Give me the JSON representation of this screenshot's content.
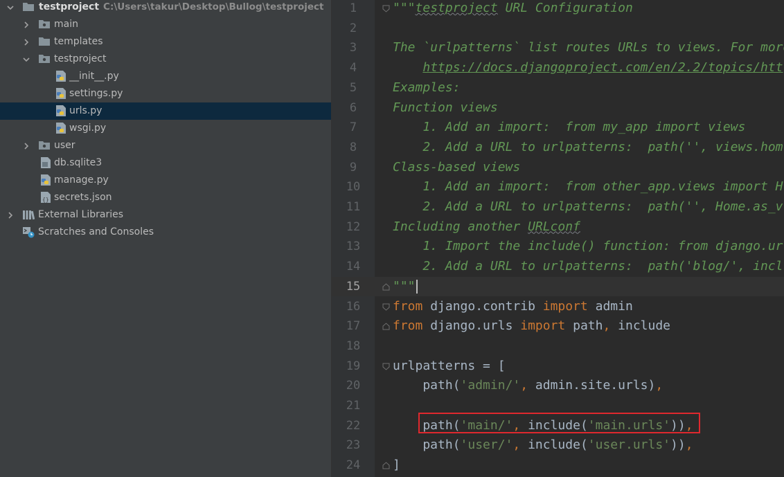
{
  "project_tree": {
    "root": {
      "label": "testproject",
      "path": "C:\\Users\\takur\\Desktop\\Bullog\\testproject"
    },
    "items": [
      {
        "label": "main",
        "type": "folder",
        "expanded": false
      },
      {
        "label": "templates",
        "type": "folder",
        "expanded": false
      },
      {
        "label": "testproject",
        "type": "folder",
        "expanded": true
      },
      {
        "label": "__init__.py",
        "type": "python-file"
      },
      {
        "label": "settings.py",
        "type": "python-file"
      },
      {
        "label": "urls.py",
        "type": "python-file",
        "selected": true
      },
      {
        "label": "wsgi.py",
        "type": "python-file"
      },
      {
        "label": "user",
        "type": "folder",
        "expanded": false
      },
      {
        "label": "db.sqlite3",
        "type": "file"
      },
      {
        "label": "manage.py",
        "type": "python-file"
      },
      {
        "label": "secrets.json",
        "type": "json-file"
      },
      {
        "label": "External Libraries",
        "type": "libraries"
      },
      {
        "label": "Scratches and Consoles",
        "type": "scratches"
      }
    ]
  },
  "editor": {
    "current_line": 15,
    "line_numbers": [
      "1",
      "2",
      "3",
      "4",
      "5",
      "6",
      "7",
      "8",
      "9",
      "10",
      "11",
      "12",
      "13",
      "14",
      "15",
      "16",
      "17",
      "18",
      "19",
      "20",
      "21",
      "22",
      "23",
      "24"
    ],
    "lines": [
      {
        "t1": "\"\"\"",
        "t2": "testproject",
        "t3": " URL Configuration"
      },
      {
        "t1": ""
      },
      {
        "t1": "The `urlpatterns` list routes URLs to views. For more"
      },
      {
        "t1": "    ",
        "t2": "https://docs.djangoproject.com/en/2.2/topics/htt"
      },
      {
        "t1": "Examples:"
      },
      {
        "t1": "Function views"
      },
      {
        "t1": "    1. Add an import:  from my_app import views"
      },
      {
        "t1": "    2. Add a URL to urlpatterns:  path('', views.hom"
      },
      {
        "t1": "Class-based views"
      },
      {
        "t1": "    1. Add an import:  from other_app.views import H"
      },
      {
        "t1": "    2. Add a URL to urlpatterns:  path('', Home.as_v"
      },
      {
        "t1": "Including another ",
        "t2": "URLconf"
      },
      {
        "t1": "    1. Import the include() function: from django.ur"
      },
      {
        "t1": "    2. Add a URL to urlpatterns:  path('blog/', incl"
      },
      {
        "t1": "\"\"\""
      },
      {
        "t1": "from",
        "t2": " django.contrib ",
        "t3": "import",
        "t4": " admin"
      },
      {
        "t1": "from",
        "t2": " django.urls ",
        "t3": "import",
        "t4": " path",
        "t5": ",",
        "t6": " include"
      },
      {
        "t1": ""
      },
      {
        "t1": "urlpatterns = ["
      },
      {
        "t1": "    path(",
        "t2": "'admin/'",
        "t3": ",",
        "t4": " admin.site.urls)",
        "t5": ","
      },
      {
        "t1": ""
      },
      {
        "t1": "    path(",
        "t2": "'main/'",
        "t3": ",",
        "t4": " include(",
        "t5": "'main.urls'",
        "t6": "))",
        "t7": ","
      },
      {
        "t1": "    path(",
        "t2": "'user/'",
        "t3": ",",
        "t4": " include(",
        "t5": "'user.urls'",
        "t6": "))",
        "t7": ","
      },
      {
        "t1": "]"
      }
    ]
  },
  "colors": {
    "background": "#2b2b2b",
    "tree_background": "#3c3f41",
    "selection": "#0d293e",
    "keyword": "#cc7832",
    "string": "#6a8759",
    "docstring": "#629755",
    "highlight_box": "#e0282e"
  }
}
